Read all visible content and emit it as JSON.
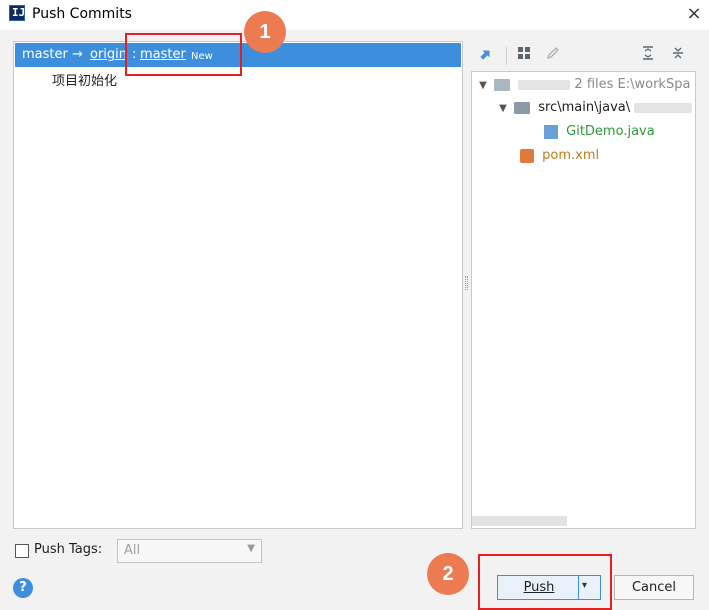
{
  "window": {
    "title": "Push Commits",
    "close_icon": "×"
  },
  "branch": {
    "local": "master",
    "arrow": "→",
    "remote": "origin",
    "separator": ":",
    "target": "master",
    "badge": "New"
  },
  "commits": [
    {
      "message": "项目初始化"
    }
  ],
  "files_panel": {
    "root_summary": "2 files  E:\\workSpa",
    "folder": "src\\main\\java\\",
    "files": [
      {
        "name": "GitDemo.java",
        "color": "#2f9a3a"
      },
      {
        "name": "pom.xml",
        "color": "#c47a1a"
      }
    ],
    "toolbar_icons": [
      "arrows-icon",
      "group-by-icon",
      "edit-icon",
      "expand-all-icon",
      "collapse-all-icon"
    ]
  },
  "bottom": {
    "push_tags_label": "Push Tags:",
    "tags_value": "All",
    "help": "?",
    "push_label": "Push",
    "push_dropdown": "▾",
    "cancel_label": "Cancel"
  },
  "annotations": [
    {
      "number": "1"
    },
    {
      "number": "2"
    }
  ],
  "colors": {
    "selection": "#3d8fde",
    "annotation_red": "#e52020",
    "annotation_circle": "#ec7b52"
  }
}
